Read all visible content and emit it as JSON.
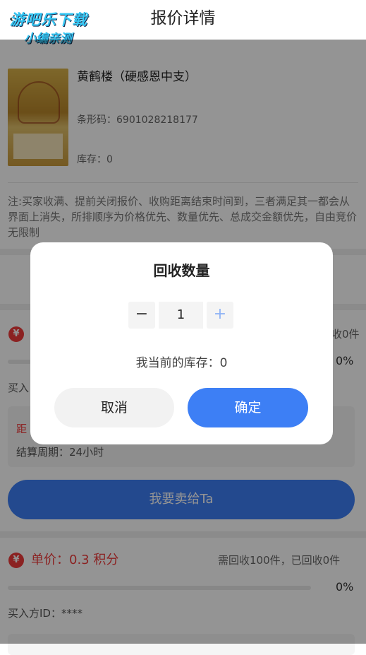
{
  "header": {
    "title": "报价详情",
    "back_glyph": "‹",
    "watermark_line1": "游吧乐下载",
    "watermark_line2": "小编亲测"
  },
  "product": {
    "name": "黄鹤楼（硬感恩中支）",
    "barcode": "条形码：6901028218177",
    "stock": "库存：0",
    "image": "cigarette-pack-image"
  },
  "note": "注:买家收满、提前关闭报价、收购距离结束时间到，三者满足其一都会从界面上消失，所排顺序为价格优先、数量优先、总成交金额优先，自由竞价无限制",
  "offer1": {
    "badge": "¥",
    "need_partial": "收0件",
    "progress_percent": 0,
    "percent_text": "0%",
    "buyer_partial": "买入",
    "countdown_partial": "距",
    "period": "结算周期：24小时",
    "sell_button": "我要卖给Ta"
  },
  "offer2": {
    "badge": "¥",
    "unit_price": "单价：0.3 积分",
    "need": "需回收100件，已回收0件",
    "progress_percent": 0,
    "percent_text": "0%",
    "buyer": "买入方ID：****"
  },
  "modal": {
    "title": "回收数量",
    "minus": "−",
    "quantity": "1",
    "plus": "+",
    "current_stock": "我当前的库存：0",
    "cancel": "取消",
    "confirm": "确定"
  },
  "colors": {
    "accent": "#3d7ff5",
    "price_red": "#ef3b3b",
    "overlay": "rgba(0,0,0,0.42)"
  }
}
